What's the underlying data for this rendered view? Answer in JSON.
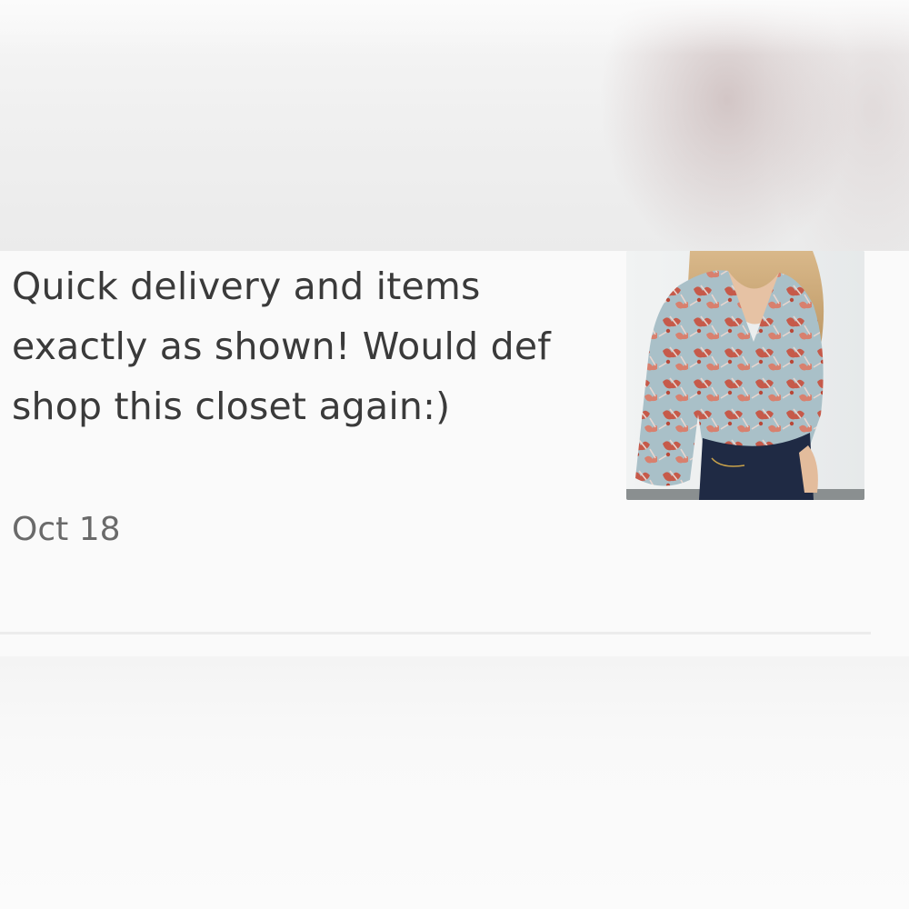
{
  "review": {
    "text": "Quick delivery and items exactly as shown! Would def shop this closet again:)",
    "date": "Oct 18",
    "thumbnail_icon": "floral-blouse-product-photo"
  },
  "colors": {
    "text": "#3a3a3a",
    "date": "#6a6a6a",
    "divider": "#ececec",
    "background": "#fafafa"
  }
}
